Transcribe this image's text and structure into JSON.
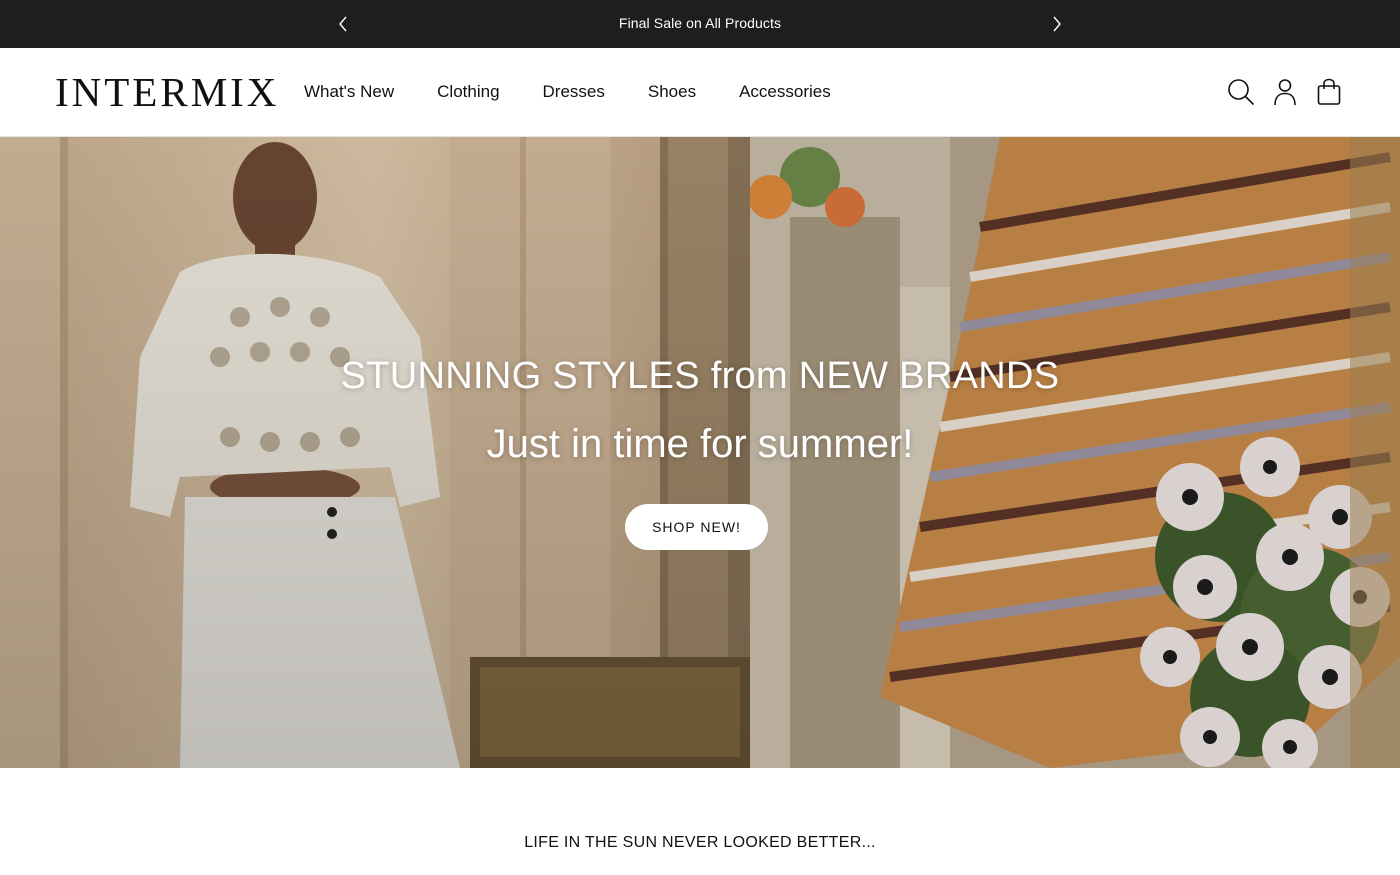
{
  "promo": {
    "text": "Final Sale on All Products",
    "prev_icon": "chevron-left-icon",
    "next_icon": "chevron-right-icon"
  },
  "header": {
    "logo": "INTERMIX",
    "nav": [
      {
        "label": "What's New"
      },
      {
        "label": "Clothing"
      },
      {
        "label": "Dresses"
      },
      {
        "label": "Shoes"
      },
      {
        "label": "Accessories"
      }
    ],
    "icons": [
      "search-icon",
      "account-icon",
      "shopping-bag-icon"
    ]
  },
  "hero": {
    "title": "STUNNING STYLES from NEW BRANDS",
    "subtitle": "Just in time for summer!",
    "cta_label": "SHOP NEW!"
  },
  "tagline": "LIFE IN THE SUN NEVER LOOKED BETTER...",
  "colors": {
    "promo_bg": "#1e1e1e",
    "text": "#111111",
    "white": "#ffffff"
  }
}
